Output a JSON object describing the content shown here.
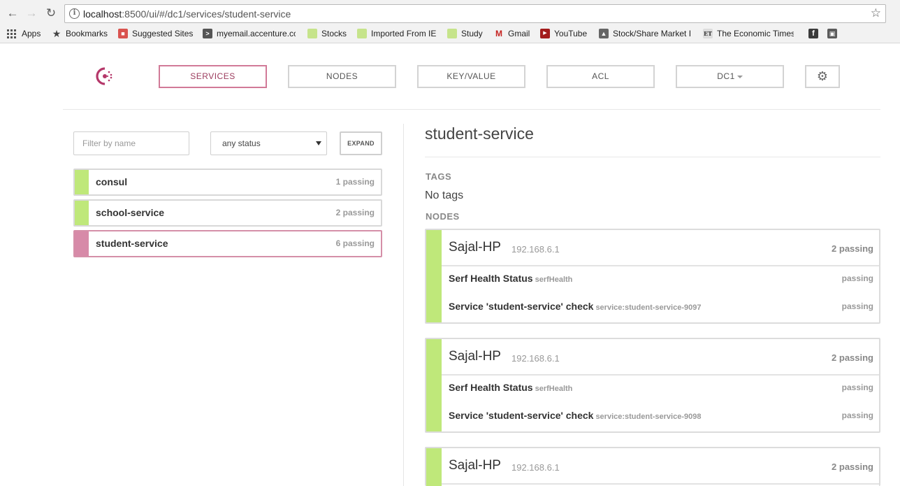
{
  "browser": {
    "url_host": "localhost",
    "url_rest": ":8500/ui/#/dc1/services/student-service",
    "bookmarks": [
      {
        "label": "Apps",
        "icon": "apps-grid-icon"
      },
      {
        "label": "Bookmarks",
        "icon": "star-icon"
      },
      {
        "label": "Suggested Sites",
        "icon": "suggested-sites-icon",
        "color": "#d9534f"
      },
      {
        "label": "myemail.accenture.cc",
        "icon": "accenture-icon",
        "color": "#555555"
      },
      {
        "label": "Stocks",
        "icon": "folder-icon",
        "color": "#c6e48b"
      },
      {
        "label": "Imported From IE",
        "icon": "folder-icon",
        "color": "#c6e48b"
      },
      {
        "label": "Study",
        "icon": "folder-icon",
        "color": "#c6e48b"
      },
      {
        "label": "Gmail",
        "icon": "gmail-icon",
        "color": "#c5221f"
      },
      {
        "label": "YouTube",
        "icon": "youtube-icon",
        "color": "#a31c1c"
      },
      {
        "label": "Stock/Share Market I",
        "icon": "stock-icon",
        "color": "#666666"
      },
      {
        "label": "The Economic Times",
        "icon": "et-icon",
        "color": "#888888"
      }
    ]
  },
  "nav": {
    "items": [
      {
        "label": "SERVICES",
        "active": true
      },
      {
        "label": "NODES",
        "active": false
      },
      {
        "label": "KEY/VALUE",
        "active": false
      },
      {
        "label": "ACL",
        "active": false
      }
    ],
    "datacenter": "DC1"
  },
  "filter": {
    "placeholder": "Filter by name",
    "status_value": "any status",
    "expand_label": "EXPAND"
  },
  "services": [
    {
      "name": "consul",
      "count": "1 passing",
      "selected": false
    },
    {
      "name": "school-service",
      "count": "2 passing",
      "selected": false
    },
    {
      "name": "student-service",
      "count": "6 passing",
      "selected": true
    }
  ],
  "detail": {
    "title": "student-service",
    "tags_label": "TAGS",
    "tags_value": "No tags",
    "nodes_label": "NODES",
    "nodes": [
      {
        "name": "Sajal-HP",
        "ip": "192.168.6.1",
        "status": "2 passing",
        "checks": [
          {
            "name": "Serf Health Status",
            "id": "serfHealth",
            "status": "passing"
          },
          {
            "name": "Service 'student-service' check",
            "id": "service:student-service-9097",
            "status": "passing"
          }
        ]
      },
      {
        "name": "Sajal-HP",
        "ip": "192.168.6.1",
        "status": "2 passing",
        "checks": [
          {
            "name": "Serf Health Status",
            "id": "serfHealth",
            "status": "passing"
          },
          {
            "name": "Service 'student-service' check",
            "id": "service:student-service-9098",
            "status": "passing"
          }
        ]
      },
      {
        "name": "Sajal-HP",
        "ip": "192.168.6.1",
        "status": "2 passing",
        "checks": []
      }
    ]
  },
  "colors": {
    "passing": "#bfe87a",
    "selected": "#d78aa8",
    "active_nav": "#d17a98"
  }
}
